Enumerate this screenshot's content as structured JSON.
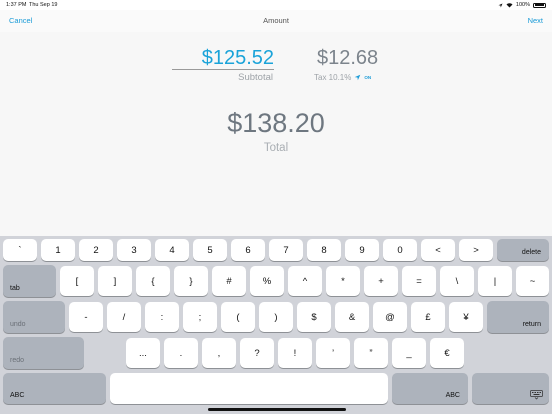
{
  "status_bar": {
    "time": "1:37 PM",
    "date": "Thu Sep 19",
    "battery": "100%"
  },
  "nav": {
    "cancel": "Cancel",
    "title": "Amount",
    "next": "Next"
  },
  "amount": {
    "subtotal_value": "$125.52",
    "subtotal_label": "Subtotal",
    "tax_value": "$12.68",
    "tax_label": "Tax 10.1%",
    "tax_location_status": "ON",
    "total_value": "$138.20",
    "total_label": "Total"
  },
  "keyboard": {
    "row1": [
      "`",
      "1",
      "2",
      "3",
      "4",
      "5",
      "6",
      "7",
      "8",
      "9",
      "0",
      "<",
      ">"
    ],
    "delete": "delete",
    "tab": "tab",
    "row2": [
      "[",
      "]",
      "{",
      "}",
      "#",
      "%",
      "^",
      "*",
      "+",
      "=",
      "\\",
      "|",
      "~"
    ],
    "undo": "undo",
    "row3": [
      "-",
      "/",
      ":",
      ";",
      "(",
      ")",
      "$",
      "&",
      "@",
      "£",
      "¥"
    ],
    "return": "return",
    "redo": "redo",
    "row4": [
      "...",
      ".",
      ",",
      "?",
      "!",
      "’",
      "”",
      "_",
      "€"
    ],
    "abc_left": "ABC",
    "abc_right": "ABC"
  }
}
